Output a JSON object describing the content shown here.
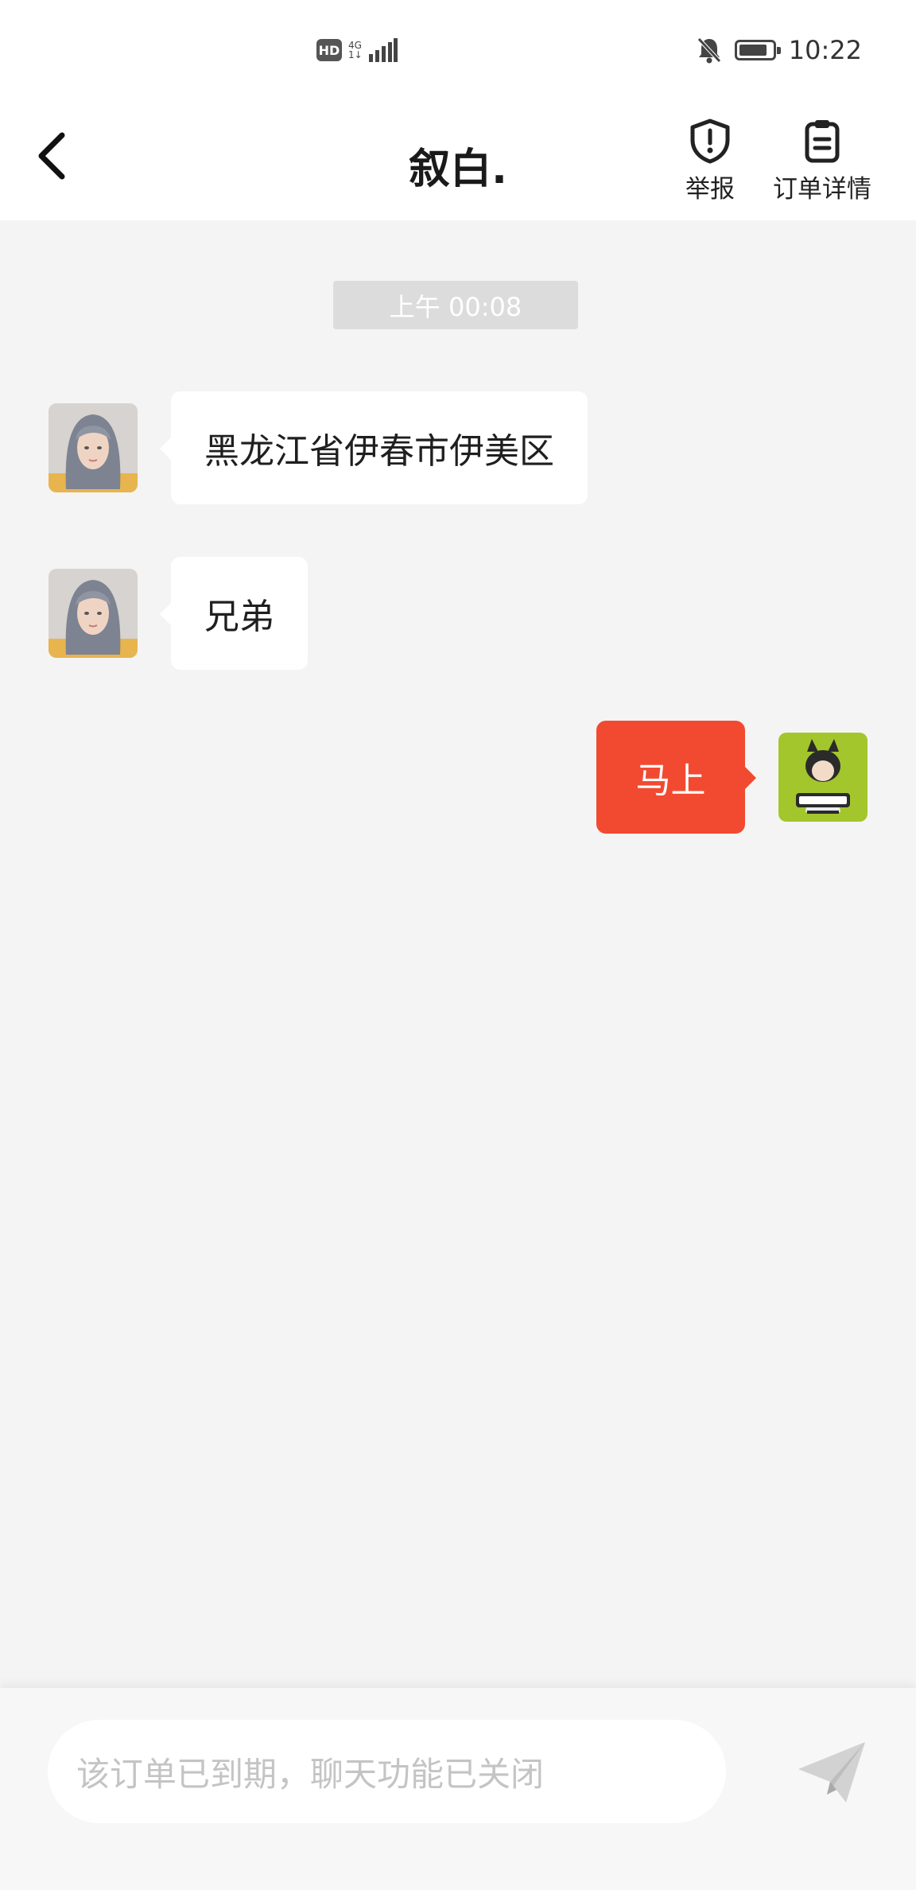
{
  "status_bar": {
    "hd_label": "HD",
    "network_label": "4G",
    "network_sub": "1↓",
    "time": "10:22",
    "battery_level": 0.85
  },
  "header": {
    "title": "叙白.",
    "report_label": "举报",
    "order_details_label": "订单详情"
  },
  "chat": {
    "timestamp": "上午 00:08",
    "messages": [
      {
        "side": "incoming",
        "text": "黑龙江省伊春市伊美区"
      },
      {
        "side": "incoming",
        "text": "兄弟"
      },
      {
        "side": "outgoing",
        "text": "马上"
      }
    ]
  },
  "input": {
    "placeholder": "该订单已到期，聊天功能已关闭"
  },
  "colors": {
    "accent": "#f24a31",
    "background": "#f4f4f4",
    "timestamp_bg": "#dcdcdc"
  }
}
